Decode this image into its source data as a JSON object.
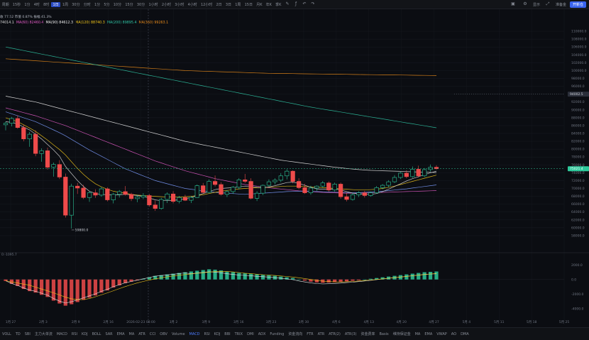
{
  "toolbar": {
    "title": "周期",
    "timeframes": [
      "15秒",
      "1分",
      "4时",
      "8时",
      "1日",
      "1周",
      "30分",
      "分时",
      "1分",
      "5分",
      "10分",
      "15分",
      "30分",
      "1小时",
      "2小时",
      "3小时",
      "4小时",
      "12小时",
      "2日",
      "3日",
      "1周",
      "15日",
      "月K",
      "年K",
      "季K"
    ],
    "active_index": 4,
    "right_label": "显示",
    "account": "准备金",
    "action": "开新仓"
  },
  "legend": {
    "row2": "收 77.52 市值 0.87% 振幅 41.3%",
    "ma": [
      {
        "text": "74014.1",
        "color": "#d9d9d9"
      },
      {
        "text": "MA(60) 82460.4",
        "color": "#e05ac4"
      },
      {
        "text": "MA(90) 84612.3",
        "color": "#e8e8e8"
      },
      {
        "text": "MA(120) 88740.3",
        "color": "#f0c419"
      },
      {
        "text": "MA(200) 89895.4",
        "color": "#2fc3a3"
      },
      {
        "text": "MA(360) 99263.1",
        "color": "#e88a1a"
      }
    ]
  },
  "price_axis": {
    "ticks": [
      "110000.0",
      "108000.0",
      "106000.0",
      "104000.0",
      "102000.0",
      "100000.0",
      "98000.0",
      "96000.0",
      "94000.0",
      "92000.0",
      "90000.0",
      "88000.0",
      "86000.0",
      "84000.0",
      "82000.0",
      "80000.0",
      "78000.0",
      "76000.0",
      "74000.0",
      "72000.0",
      "70000.0",
      "68000.0",
      "66000.0",
      "64000.0",
      "62000.0",
      "60000.0",
      "58000.0"
    ],
    "current_price": "75021.4",
    "marker_price": "94002.5"
  },
  "macd_axis": {
    "ticks": [
      "2000.0",
      "0.0",
      "-2000.0",
      "-4000.0"
    ],
    "label": "0:-1095.7"
  },
  "low_annotation": "59800.0",
  "date_axis": [
    "1月 27",
    "2月 3",
    "2月 9",
    "2月 16",
    "2026-02-23 08:00",
    "3月 2",
    "3月 9",
    "3月 16",
    "3月 23",
    "3月 30",
    "4月 6",
    "4月 13",
    "4月 20",
    "4月 27",
    "5月 4",
    "5月 11",
    "5月 18",
    "5月 25"
  ],
  "indicators": [
    "VOLL",
    "TD",
    "SBI",
    "主力大单流",
    "MACD",
    "RSI",
    "KDJ",
    "BOLL",
    "SAR",
    "EMA",
    "MA",
    "ATR",
    "CCI",
    "OBV",
    "Volume",
    "MACD",
    "RSI",
    "KDJ",
    "BBI",
    "TRIX",
    "DMI",
    "ADX",
    "Funding",
    "资金流向",
    "FTR",
    "ATR",
    "ATR(2)",
    "ATR(3)",
    "资金费率",
    "Basis",
    "维持保证金",
    "MA",
    "EMA",
    "VWAP",
    "AO",
    "DMA"
  ],
  "active_indicator": 15,
  "colors": {
    "bull": "#2ec99b",
    "bear": "#ef4b4b",
    "accent": "#2a4cc2"
  },
  "chart_data": {
    "type": "candlestick",
    "y_range": [
      56000,
      112000
    ],
    "candles": [
      [
        86200,
        87000,
        84800,
        86600
      ],
      [
        86600,
        88200,
        85800,
        87800
      ],
      [
        87800,
        88600,
        85200,
        85500
      ],
      [
        85500,
        86200,
        82000,
        82600
      ],
      [
        82600,
        84400,
        80600,
        83800
      ],
      [
        83800,
        84800,
        78200,
        78900
      ],
      [
        78900,
        80200,
        76800,
        79600
      ],
      [
        79600,
        80400,
        74800,
        75400
      ],
      [
        75400,
        76600,
        73000,
        76100
      ],
      [
        76100,
        77200,
        72400,
        72900
      ],
      [
        72900,
        73800,
        62600,
        63200
      ],
      [
        63200,
        71200,
        59800,
        70600
      ],
      [
        70600,
        71400,
        68600,
        70100
      ],
      [
        70100,
        70900,
        67300,
        67700
      ],
      [
        67700,
        69200,
        66600,
        68900
      ],
      [
        68900,
        69800,
        67600,
        68300
      ],
      [
        68300,
        70400,
        67900,
        69900
      ],
      [
        69900,
        70300,
        66700,
        67100
      ],
      [
        67100,
        68900,
        66200,
        68500
      ],
      [
        68500,
        69600,
        67700,
        69200
      ],
      [
        69200,
        70600,
        68200,
        68500
      ],
      [
        68500,
        68900,
        66800,
        67400
      ],
      [
        67400,
        68400,
        66500,
        67800
      ],
      [
        67800,
        68800,
        67300,
        68200
      ],
      [
        68200,
        68600,
        65400,
        65800
      ],
      [
        65800,
        66900,
        64300,
        64900
      ],
      [
        64900,
        67600,
        64600,
        67200
      ],
      [
        67200,
        69000,
        66300,
        68600
      ],
      [
        68600,
        69300,
        66200,
        66700
      ],
      [
        66700,
        68100,
        66200,
        67700
      ],
      [
        67700,
        68400,
        66800,
        67000
      ],
      [
        67000,
        68100,
        66300,
        67700
      ],
      [
        67700,
        71000,
        67600,
        70700
      ],
      [
        70700,
        71400,
        68700,
        69000
      ],
      [
        69000,
        72300,
        68800,
        71800
      ],
      [
        71800,
        73300,
        70500,
        71000
      ],
      [
        71000,
        71600,
        68200,
        68500
      ],
      [
        68500,
        69600,
        67800,
        69200
      ],
      [
        69200,
        70600,
        68600,
        70300
      ],
      [
        70300,
        72600,
        69800,
        72200
      ],
      [
        72200,
        73700,
        71400,
        71800
      ],
      [
        71800,
        72600,
        67200,
        67500
      ],
      [
        67500,
        69300,
        66800,
        68800
      ],
      [
        68800,
        71000,
        68300,
        70800
      ],
      [
        70800,
        72300,
        70400,
        71700
      ],
      [
        71700,
        72600,
        71000,
        72100
      ],
      [
        72100,
        73900,
        71600,
        73200
      ],
      [
        73200,
        74900,
        72300,
        74400
      ],
      [
        74400,
        74600,
        71300,
        71800
      ],
      [
        71800,
        72600,
        69800,
        70200
      ],
      [
        70200,
        71200,
        68600,
        68900
      ],
      [
        68900,
        70700,
        68400,
        70100
      ],
      [
        70100,
        70800,
        69400,
        70600
      ],
      [
        70600,
        71900,
        70200,
        71400
      ],
      [
        71400,
        71800,
        69200,
        69600
      ],
      [
        69600,
        71500,
        69200,
        71100
      ],
      [
        71100,
        71500,
        67400,
        67900
      ],
      [
        67900,
        68900,
        66700,
        67200
      ],
      [
        67200,
        68800,
        66900,
        68400
      ],
      [
        68400,
        69300,
        67800,
        68900
      ],
      [
        68900,
        69400,
        67700,
        68200
      ],
      [
        68200,
        69200,
        67900,
        68900
      ],
      [
        68900,
        70600,
        68700,
        70200
      ],
      [
        70200,
        71100,
        69800,
        70800
      ],
      [
        70800,
        72100,
        70300,
        71700
      ],
      [
        71700,
        73400,
        71400,
        72800
      ],
      [
        72800,
        74200,
        72400,
        73900
      ],
      [
        73900,
        74600,
        72600,
        73000
      ],
      [
        73000,
        75600,
        72700,
        74900
      ],
      [
        74900,
        75800,
        72800,
        73200
      ],
      [
        73200,
        75200,
        72900,
        74800
      ],
      [
        74800,
        76100,
        74300,
        75400
      ],
      [
        75400,
        75900,
        74800,
        75021
      ]
    ],
    "macd": [
      -200,
      -600,
      -900,
      -1300,
      -1600,
      -1800,
      -2100,
      -2400,
      -2900,
      -3300,
      -3600,
      -3400,
      -3100,
      -2800,
      -2500,
      -2200,
      -1800,
      -1500,
      -1100,
      -800,
      -500,
      -300,
      -100,
      100,
      300,
      500,
      600,
      700,
      800,
      900,
      1000,
      1100,
      1200,
      1300,
      1400,
      1350,
      1250,
      1100,
      1000,
      900,
      850,
      800,
      700,
      650,
      600,
      500,
      400,
      300,
      200,
      0,
      -150,
      -300,
      -400,
      -450,
      -420,
      -380,
      -320,
      -250,
      -180,
      -100,
      0,
      100,
      200,
      300,
      400,
      500,
      600,
      700,
      800,
      900,
      1000,
      1050,
      1100
    ],
    "ma_lines": [
      {
        "name": "MA(360)",
        "color": "#e88a1a",
        "values": [
          103000,
          102900,
          102800,
          102700,
          102600,
          102500,
          102400,
          102300,
          102200,
          102100,
          102000,
          101900,
          101800,
          101700,
          101600,
          101500,
          101400,
          101300,
          101200,
          101100,
          101000,
          100900,
          100800,
          100700,
          100600,
          100500,
          100400,
          100300,
          100200,
          100100,
          100000,
          99950,
          99900,
          99850,
          99800,
          99750,
          99700,
          99650,
          99600,
          99550,
          99500,
          99450,
          99400,
          99350,
          99300,
          99280,
          99260,
          99240,
          99220,
          99200,
          99180,
          99160,
          99140,
          99120,
          99100,
          99080,
          99060,
          99040,
          99020,
          99000,
          98980,
          98960,
          98940,
          98920,
          98900,
          98880,
          98860,
          98840,
          98820,
          98800,
          98780,
          98760,
          98740
        ]
      },
      {
        "name": "MA(200)",
        "color": "#2fc3a3",
        "values": [
          106000,
          105700,
          105400,
          105100,
          104800,
          104500,
          104200,
          103900,
          103600,
          103300,
          103000,
          102700,
          102400,
          102100,
          101800,
          101500,
          101200,
          100900,
          100600,
          100300,
          100000,
          99700,
          99400,
          99100,
          98800,
          98500,
          98200,
          97900,
          97600,
          97300,
          97000,
          96700,
          96400,
          96100,
          95800,
          95500,
          95200,
          94900,
          94600,
          94300,
          94000,
          93700,
          93400,
          93100,
          92800,
          92500,
          92200,
          91900,
          91600,
          91300,
          91000,
          90700,
          90450,
          90200,
          89950,
          89700,
          89450,
          89200,
          88950,
          88700,
          88450,
          88200,
          87950,
          87700,
          87450,
          87200,
          86950,
          86700,
          86450,
          86200,
          85950,
          85700,
          85450
        ]
      },
      {
        "name": "MA(120)",
        "color": "#e8e8e8",
        "values": [
          93500,
          93200,
          92900,
          92600,
          92300,
          92000,
          91600,
          91200,
          90800,
          90400,
          90000,
          89600,
          89200,
          88800,
          88400,
          88000,
          87600,
          87200,
          86800,
          86400,
          86000,
          85600,
          85200,
          84800,
          84400,
          84000,
          83600,
          83200,
          82800,
          82400,
          82000,
          81700,
          81400,
          81100,
          80800,
          80500,
          80200,
          79900,
          79600,
          79300,
          79000,
          78700,
          78400,
          78100,
          77800,
          77500,
          77200,
          77000,
          76800,
          76600,
          76400,
          76200,
          76000,
          75800,
          75600,
          75400,
          75250,
          75100,
          74950,
          74800,
          74700,
          74600,
          74550,
          74500,
          74450,
          74400,
          74350,
          74300,
          74250,
          74200,
          74150,
          74100,
          74050
        ]
      },
      {
        "name": "MA(90)",
        "color": "#e05ac4",
        "values": [
          90500,
          90100,
          89700,
          89300,
          88900,
          88500,
          88000,
          87500,
          87000,
          86500,
          86000,
          85400,
          84800,
          84200,
          83600,
          83000,
          82400,
          81800,
          81200,
          80600,
          80000,
          79400,
          78800,
          78200,
          77600,
          77000,
          76500,
          76000,
          75500,
          75000,
          74500,
          74100,
          73700,
          73300,
          72900,
          72500,
          72200,
          71900,
          71600,
          71300,
          71000,
          70800,
          70600,
          70400,
          70200,
          70000,
          69850,
          69700,
          69550,
          69400,
          69300,
          69200,
          69100,
          69000,
          68950,
          68900,
          68850,
          68800,
          68800,
          68800,
          68850,
          68900,
          68950,
          69000,
          69050,
          69100,
          69150,
          69200,
          69250,
          69300,
          69350,
          69400,
          69450
        ]
      },
      {
        "name": "MA(60)",
        "color": "#7c9cff",
        "values": [
          89500,
          89000,
          88500,
          88000,
          87500,
          87000,
          86300,
          85600,
          84900,
          84200,
          83400,
          82500,
          81600,
          80700,
          79800,
          79000,
          78200,
          77400,
          76600,
          75800,
          75000,
          74400,
          73800,
          73200,
          72600,
          72000,
          71600,
          71200,
          70800,
          70400,
          70000,
          69800,
          69600,
          69400,
          69200,
          69000,
          68900,
          68800,
          68700,
          68600,
          68500,
          68600,
          68700,
          68800,
          68900,
          69000,
          69100,
          69200,
          69250,
          69300,
          69300,
          69250,
          69200,
          69150,
          69100,
          69050,
          69000,
          68950,
          68900,
          68950,
          69000,
          69100,
          69200,
          69300,
          69450,
          69600,
          69750,
          69900,
          70100,
          70300,
          70500,
          70700,
          70900
        ]
      },
      {
        "name": "MA(20)",
        "color": "#f0c419",
        "values": [
          88000,
          87500,
          87000,
          86200,
          85400,
          84500,
          83400,
          82300,
          81100,
          79900,
          78500,
          76800,
          75100,
          73600,
          72300,
          71200,
          70400,
          69800,
          69300,
          69000,
          68800,
          68500,
          68300,
          68200,
          68100,
          68000,
          67900,
          67800,
          67800,
          67800,
          67900,
          68000,
          68200,
          68400,
          68700,
          69000,
          69300,
          69500,
          69700,
          69900,
          70000,
          70100,
          70200,
          70200,
          70300,
          70400,
          70500,
          70600,
          70600,
          70600,
          70500,
          70400,
          70300,
          70200,
          70100,
          70000,
          69900,
          69800,
          69700,
          69600,
          69600,
          69700,
          69800,
          70000,
          70300,
          70600,
          71000,
          71400,
          71800,
          72200,
          72600,
          73000,
          73400
        ]
      },
      {
        "name": "MA(7)",
        "color": "#d9d9d9",
        "values": [
          87000,
          86800,
          86400,
          85600,
          84900,
          83800,
          82600,
          81200,
          79800,
          78200,
          75600,
          73800,
          72000,
          70500,
          69300,
          68700,
          68500,
          68400,
          68300,
          68400,
          68500,
          68400,
          68200,
          68000,
          67600,
          67100,
          66900,
          66900,
          67000,
          67100,
          67400,
          67700,
          68200,
          68700,
          69200,
          69700,
          70000,
          70100,
          70200,
          70400,
          70600,
          70500,
          70300,
          70200,
          70400,
          70700,
          71100,
          71500,
          71600,
          71300,
          70800,
          70300,
          69900,
          69800,
          69800,
          69900,
          69600,
          69200,
          68800,
          68600,
          68500,
          68500,
          68700,
          69200,
          69800,
          70500,
          71200,
          71900,
          72500,
          73000,
          73500,
          74000,
          74400
        ]
      }
    ]
  }
}
